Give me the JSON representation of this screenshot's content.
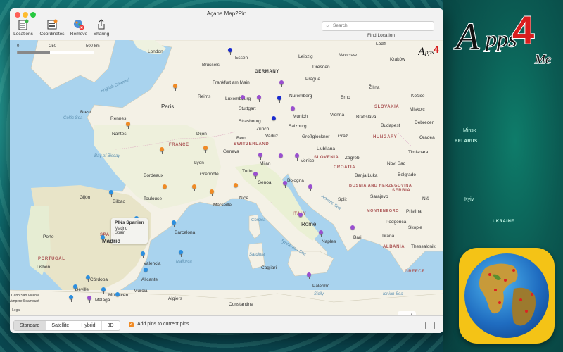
{
  "window": {
    "title": "Açana Map2Pin"
  },
  "toolbar": {
    "locations": "Locations",
    "coordinates": "Coordinates",
    "remove": "Remove",
    "sharing": "Sharing"
  },
  "search": {
    "placeholder": "Search",
    "find_label": "Find Location"
  },
  "scale": {
    "zero": "0",
    "mid": "250",
    "end": "500 km"
  },
  "callout": {
    "title": "PINs Spanien",
    "line1": "Madrid",
    "line2": "Spain"
  },
  "map_labels": {
    "london": "London",
    "brussels": "Brussels",
    "essen": "Essen",
    "germany": "GERMANY",
    "leipzig": "Leipzig",
    "dresden": "Dresden",
    "frankfurt": "Frankfurt am Main",
    "prague": "Prague",
    "nuremberg": "Nuremberg",
    "reims": "Reims",
    "paris": "Paris",
    "stuttgart": "Stuttgart",
    "munich": "Munich",
    "vienna": "Vienna",
    "bratislava": "Bratislava",
    "budapest": "Budapest",
    "rennes": "Rennes",
    "celtic_sea": "Celtic Sea",
    "english_channel": "English Channel",
    "nantes": "Nantes",
    "france": "FRANCE",
    "dijon": "Dijon",
    "vaduz": "Vaduz",
    "salzburg": "Salzburg",
    "slovakia": "SLOVAKIA",
    "hungary": "HUNGARY",
    "switzerland": "SWITZERLAND",
    "geneva": "Geneva",
    "lyon": "Lyon",
    "milan": "Milan",
    "venice": "Venice",
    "slovenia": "SLOVENIA",
    "zagreb": "Zagreb",
    "croatia": "CROATIA",
    "bay_of_biscay": "Bay of Biscay",
    "bordeaux": "Bordeaux",
    "grenoble": "Grenoble",
    "turin": "Turin",
    "genoa": "Genoa",
    "bologna": "Bologna",
    "belgrade": "Belgrade",
    "bosnia": "BOSNIA AND HERZEGOVINA",
    "serbia": "SERBIA",
    "toulouse": "Toulouse",
    "marseille": "Marseille",
    "nice": "Nice",
    "bilbao": "Bilbao",
    "gijon": "Gijón",
    "split": "Split",
    "sarajevo": "Sarajevo",
    "adriatic": "Adriatic Sea",
    "montenegro": "MONTENEGRO",
    "pristina": "Pristina",
    "barcelona": "Barcelona",
    "corsica": "Corsica",
    "rome": "Rome",
    "italy": "ITALY",
    "naples": "Naples",
    "bari": "Bari",
    "porto": "Porto",
    "spain": "SPAIN",
    "madrid": "Madrid",
    "tyrrhenian": "Tyrrhenian Sea",
    "sardinia": "Sardinia",
    "portugal": "PORTUGAL",
    "valencia": "València",
    "mallorca": "Mallorca",
    "lisbon": "Lisbon",
    "cagliari": "Cagliari",
    "greece": "GREECE",
    "cordoba": "Córdoba",
    "alicante": "Alicante",
    "seville": "Seville",
    "murcia": "Murcia",
    "palermo": "Palermo",
    "sicily": "Sicily",
    "ionian": "Ionian Sea",
    "malaga": "Málaga",
    "mulhacen": "Mulhacén",
    "algiers": "Algiers",
    "constantine": "Constantine",
    "cabo": "Cabo São Vicente",
    "ampere": "Ampere Seamount",
    "legal": "Legal",
    "timisoara": "Timisoara",
    "skopje": "Skopje",
    "tirana": "Tirana",
    "albania": "ALBANIA",
    "thessaloniki": "Thessaloniki",
    "glockner": "Großglockner",
    "graz": "Graz",
    "krakow": "Kraków",
    "wroclaw": "Wrocław",
    "brno": "Brno",
    "lodz": "Łódź",
    "kosice": "Košice",
    "zilina": "Žilina",
    "miskolc": "Miskolc",
    "oradea": "Oradea",
    "debrecen": "Debrecen",
    "banja": "Banja Luka",
    "podgorica": "Podgorica",
    "stras": "Strasbourg",
    "luxembourg": "Luxembourg",
    "nis": "Niš",
    "novi_sad": "Novi Sad",
    "bern": "Bern",
    "zurich": "Zürich",
    "ljubljana": "Ljubljana",
    "brest": "Brest"
  },
  "right_side": {
    "minsk": "Minsk",
    "belarus": "BELARUS",
    "kyiv": "Kyiv",
    "ukraine": "UKRAINE"
  },
  "bottom": {
    "standard": "Standard",
    "satellite": "Satellite",
    "hybrid": "Hybrid",
    "three_d": "3D",
    "add_pins": "Add pins to current pins"
  },
  "compass": "N",
  "zoom": {
    "minus": "−",
    "plus": "+"
  },
  "brand": {
    "logo_text": "Apps4Me",
    "letters": "A pps",
    "sub": "Me"
  },
  "colors": {
    "orange_pin": "#f08a24",
    "blue_pin": "#2b8fe0",
    "purple_pin": "#9a4fd0",
    "navy_pin": "#1a2bd0"
  }
}
